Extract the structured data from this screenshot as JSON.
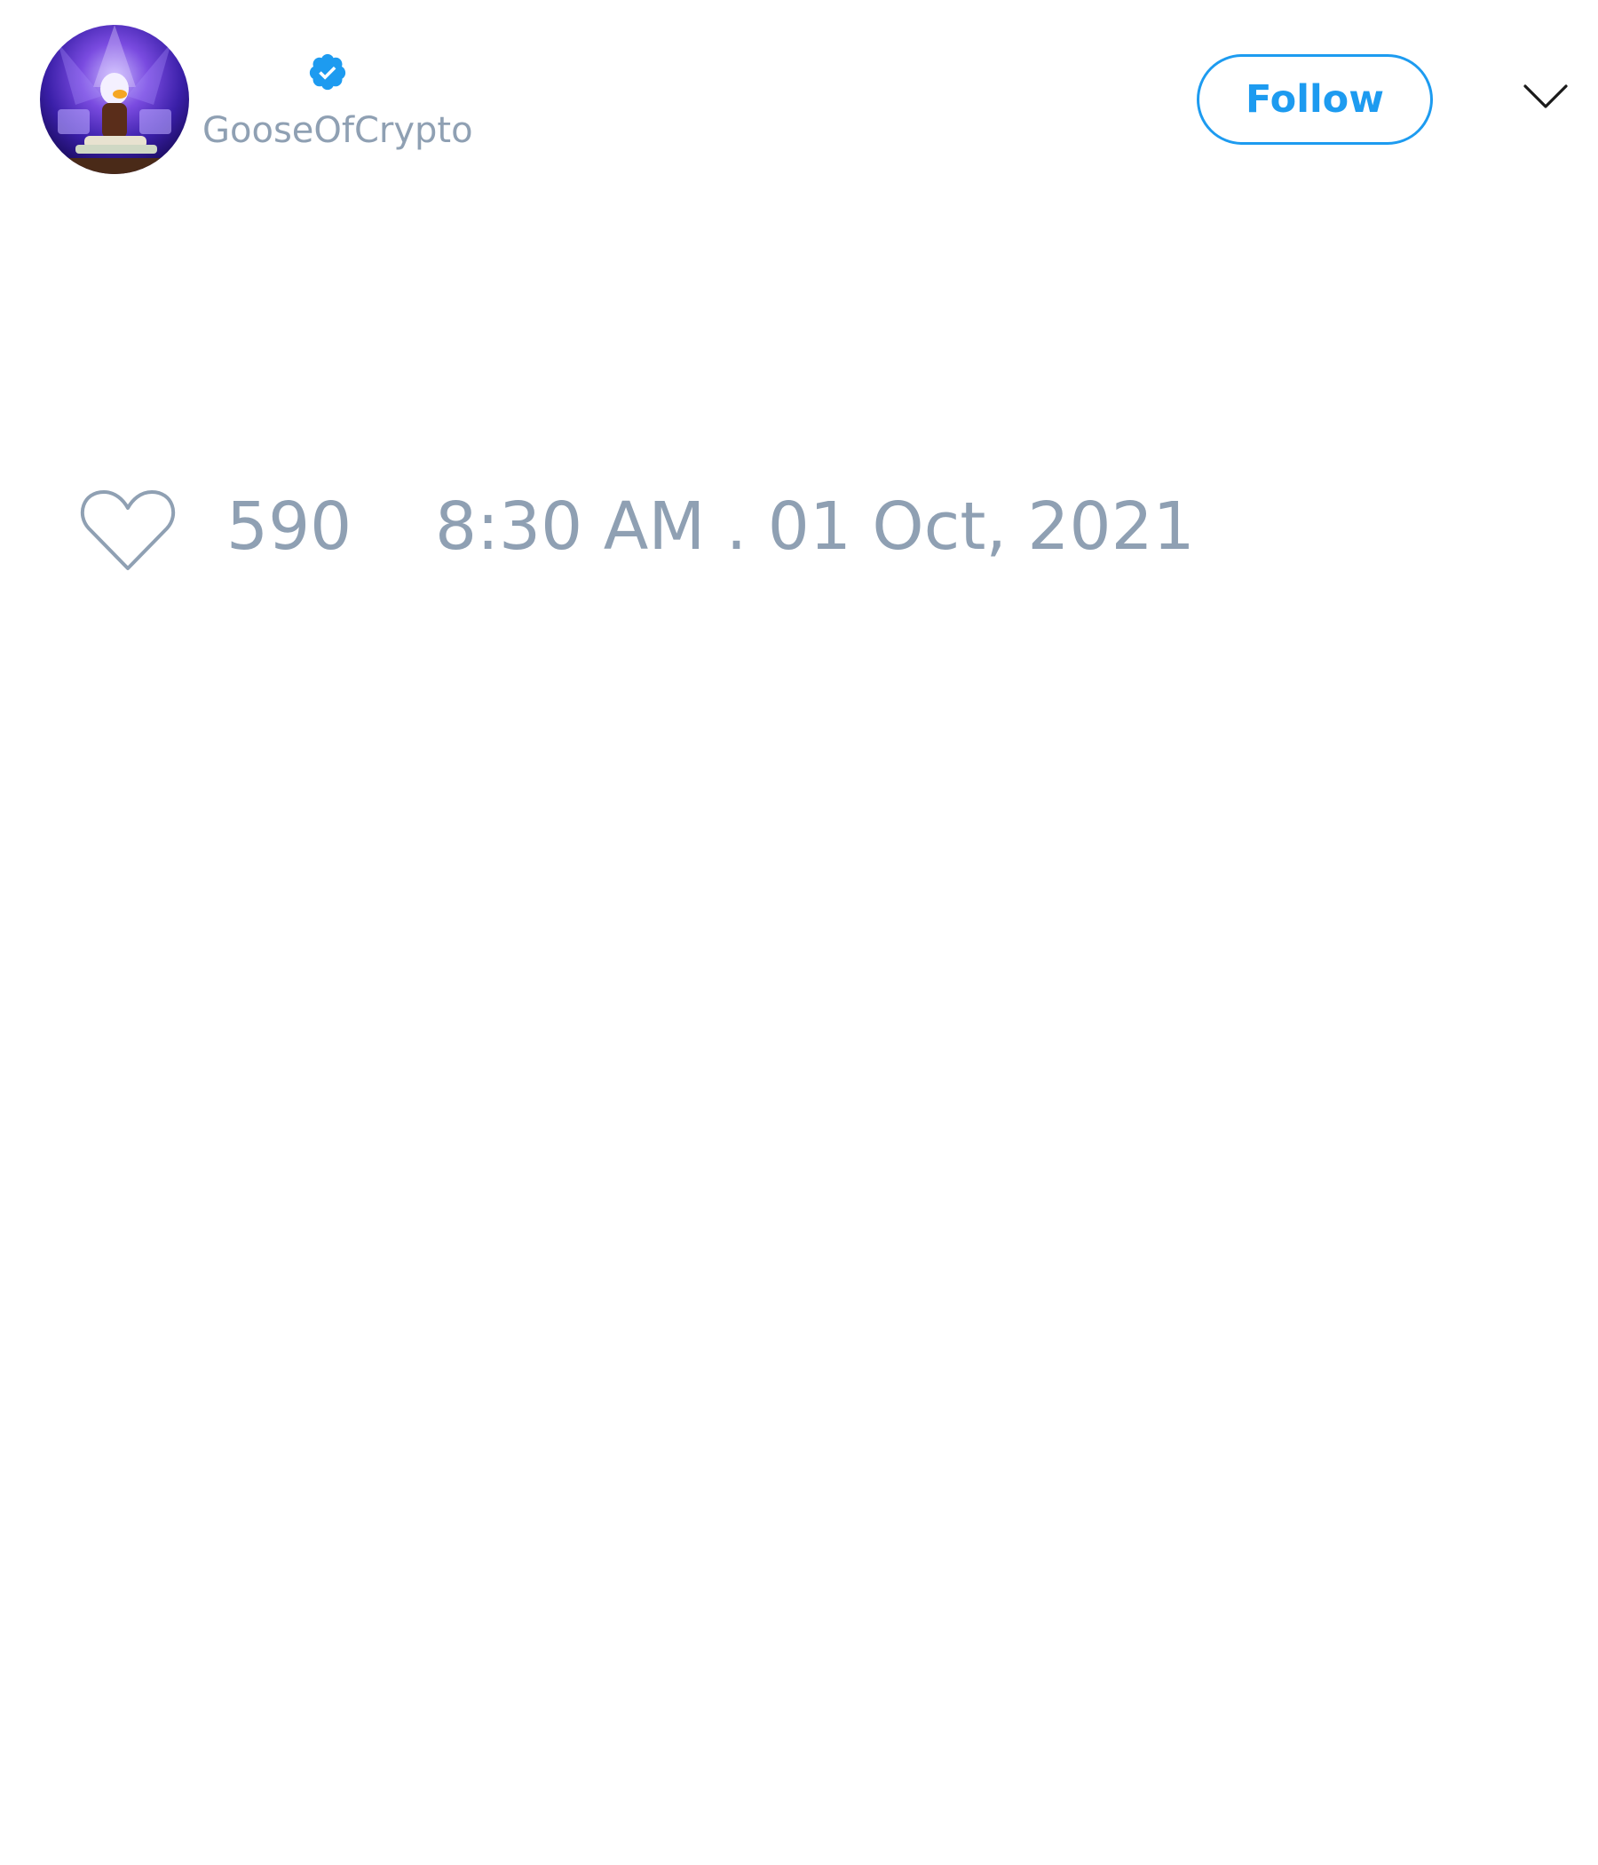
{
  "tweet": {
    "author": {
      "handle": "GooseOfCrypto",
      "verified": true,
      "avatar_icon": "duck-avatar"
    },
    "follow_label": "Follow",
    "menu_icon": "chevron-down-icon",
    "like_icon": "heart-icon",
    "like_count": "590",
    "timestamp": "8:30 AM . 01 Oct, 2021"
  },
  "colors": {
    "accent": "#1d9bf0",
    "muted_text": "#8fa0b3",
    "background": "#ffffff"
  }
}
